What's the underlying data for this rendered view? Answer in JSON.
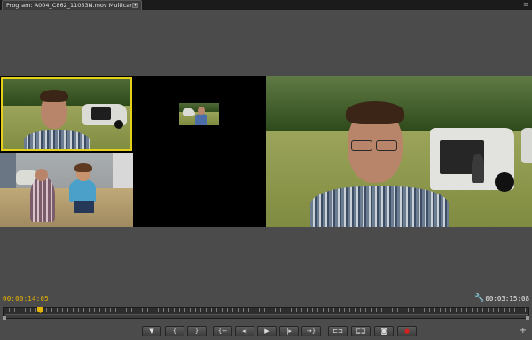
{
  "tab": {
    "label": "Program: A004_C862_11053N.mov Multicam",
    "menu_glyph": "▾"
  },
  "panel_menu_glyph": "≡",
  "timecode": {
    "current": "00:00:14:05",
    "duration": "00:03:15:08"
  },
  "icons": {
    "wrench": "🔧",
    "add": "+"
  },
  "transport": [
    {
      "name": "add-marker-button",
      "glyph": "▼"
    },
    {
      "name": "mark-in-button",
      "glyph": "{"
    },
    {
      "name": "mark-out-button",
      "glyph": "}"
    },
    {
      "name": "go-to-in-button",
      "glyph": "{←"
    },
    {
      "name": "step-back-button",
      "glyph": "◂|"
    },
    {
      "name": "play-button",
      "glyph": "▶"
    },
    {
      "name": "step-forward-button",
      "glyph": "|▸"
    },
    {
      "name": "go-to-out-button",
      "glyph": "→}"
    },
    {
      "name": "lift-button",
      "glyph": "⊏⊐"
    },
    {
      "name": "extract-button",
      "glyph": "⊑⊒"
    },
    {
      "name": "export-frame-button",
      "glyph": "◙"
    },
    {
      "name": "record-button",
      "glyph": "●"
    }
  ],
  "colors": {
    "selected_camera_border": "#e6d11a",
    "current_timecode": "#e8b200",
    "record": "#d02020"
  }
}
